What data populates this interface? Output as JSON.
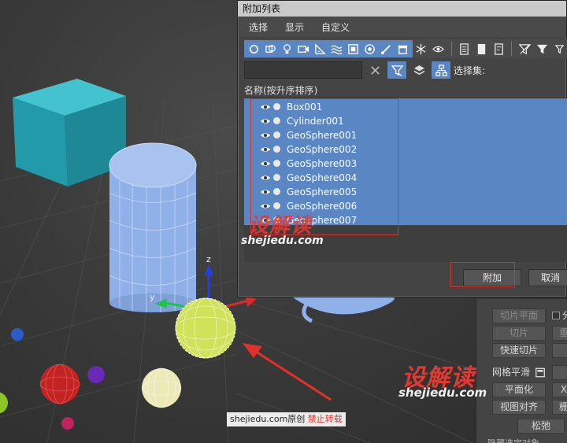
{
  "dialog": {
    "title": "附加列表",
    "menu": [
      "选择",
      "显示",
      "自定义"
    ],
    "search_placeholder": "",
    "search_value": "",
    "selection_set_label": "选择集:",
    "list_header": "名称(按升序排序)",
    "objects": [
      {
        "name": "Box001",
        "selected": true
      },
      {
        "name": "Cylinder001",
        "selected": true
      },
      {
        "name": "GeoSphere001",
        "selected": true
      },
      {
        "name": "GeoSphere002",
        "selected": true
      },
      {
        "name": "GeoSphere003",
        "selected": true
      },
      {
        "name": "GeoSphere004",
        "selected": true
      },
      {
        "name": "GeoSphere005",
        "selected": true
      },
      {
        "name": "GeoSphere006",
        "selected": true
      },
      {
        "name": "GeoSphere007",
        "selected": true
      }
    ],
    "attach_button": "附加",
    "cancel_button": "取消"
  },
  "command_panel": {
    "slice_plane": "切片平面",
    "split_partial": "分",
    "slice": "切片",
    "reset_partial": "重",
    "quick_slice": "快速切片",
    "mesh_smooth": "网格平滑",
    "planarize": "平面化",
    "x_partial": "X",
    "view_align": "视图对齐",
    "grid_partial": "栅",
    "relax": "松弛",
    "bottom_partial": "隐藏选定对象"
  },
  "viewport": {
    "axis_z": "z",
    "axis_y": "y"
  },
  "watermark": {
    "brand": "设解读",
    "url": "shejiedu.com",
    "caption_site": "shejiedu.com原创",
    "caption_warning": "禁止转载"
  },
  "colors": {
    "selection_blue": "#5b86c4",
    "annotation_red": "#d8312a",
    "box_teal": "#2aa5b5"
  }
}
